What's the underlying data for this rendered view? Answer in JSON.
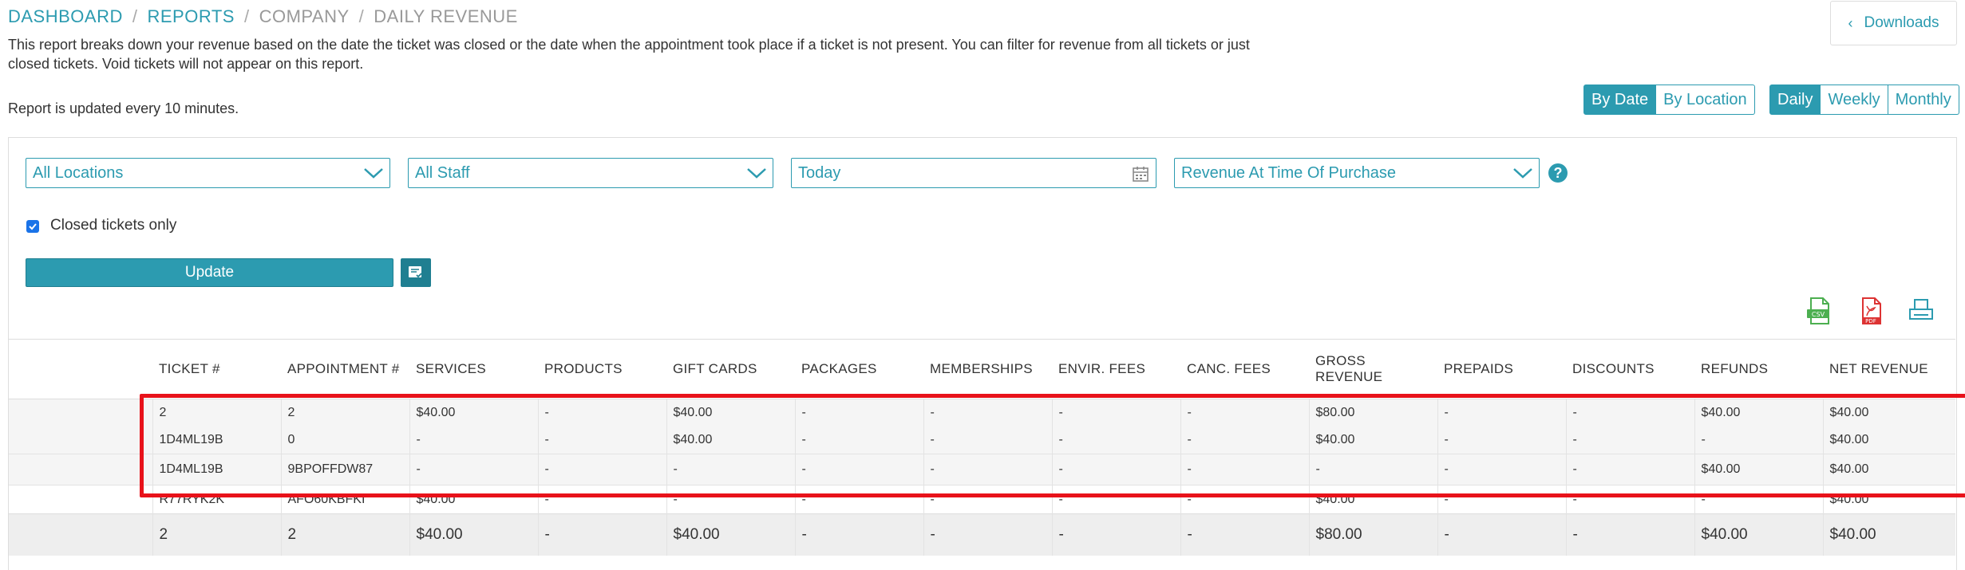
{
  "breadcrumb": {
    "dashboard": "DASHBOARD",
    "reports": "REPORTS",
    "company": "COMPANY",
    "current": "DAILY REVENUE"
  },
  "description": "This report breaks down your revenue based on the date the ticket was closed or the date when the appointment took place if a ticket is not present. You can filter for revenue from all tickets or just closed tickets. Void tickets will not appear on this report.",
  "updated_text": "Report is updated every 10 minutes.",
  "downloads_label": "Downloads",
  "view_toggle": {
    "by_date": "By Date",
    "by_location": "By Location",
    "active": "By Date"
  },
  "period_toggle": {
    "daily": "Daily",
    "weekly": "Weekly",
    "monthly": "Monthly",
    "active": "Daily"
  },
  "filters": {
    "location": "All Locations",
    "staff": "All Staff",
    "date": "Today",
    "revenue_type": "Revenue At Time Of Purchase",
    "help": "?",
    "closed_only_label": "Closed tickets only",
    "closed_only_checked": true
  },
  "update_label": "Update",
  "exports": {
    "csv": "csv-icon",
    "pdf": "pdf-icon",
    "print": "print-icon"
  },
  "table": {
    "headers": [
      "TICKET #",
      "APPOINTMENT #",
      "SERVICES",
      "PRODUCTS",
      "GIFT CARDS",
      "PACKAGES",
      "MEMBERSHIPS",
      "ENVIR. FEES",
      "CANC. FEES",
      "GROSS REVENUE",
      "PREPAIDS",
      "DISCOUNTS",
      "REFUNDS",
      "NET REVENUE"
    ],
    "summary_row": [
      "2",
      "2",
      "$40.00",
      "-",
      "$40.00",
      "-",
      "-",
      "-",
      "-",
      "$80.00",
      "-",
      "-",
      "$40.00",
      "$40.00"
    ],
    "rows": [
      [
        "1D4ML19B",
        "0",
        "-",
        "-",
        "$40.00",
        "-",
        "-",
        "-",
        "-",
        "$40.00",
        "-",
        "-",
        "-",
        "$40.00"
      ],
      [
        "1D4ML19B",
        "9BPOFFDW87",
        "-",
        "-",
        "-",
        "-",
        "-",
        "-",
        "-",
        "-",
        "-",
        "-",
        "$40.00",
        "$40.00"
      ],
      [
        "R77RYK2K",
        "AFO60KBFKI",
        "$40.00",
        "-",
        "-",
        "-",
        "-",
        "-",
        "-",
        "$40.00",
        "-",
        "-",
        "-",
        "$40.00"
      ]
    ],
    "total_row": [
      "2",
      "2",
      "$40.00",
      "-",
      "$40.00",
      "-",
      "-",
      "-",
      "-",
      "$80.00",
      "-",
      "-",
      "$40.00",
      "$40.00"
    ]
  },
  "colors": {
    "accent": "#2c9bb0",
    "refund_red": "#d5391f",
    "highlight_red": "#e8121a",
    "checkbox_blue": "#1a73e8"
  }
}
